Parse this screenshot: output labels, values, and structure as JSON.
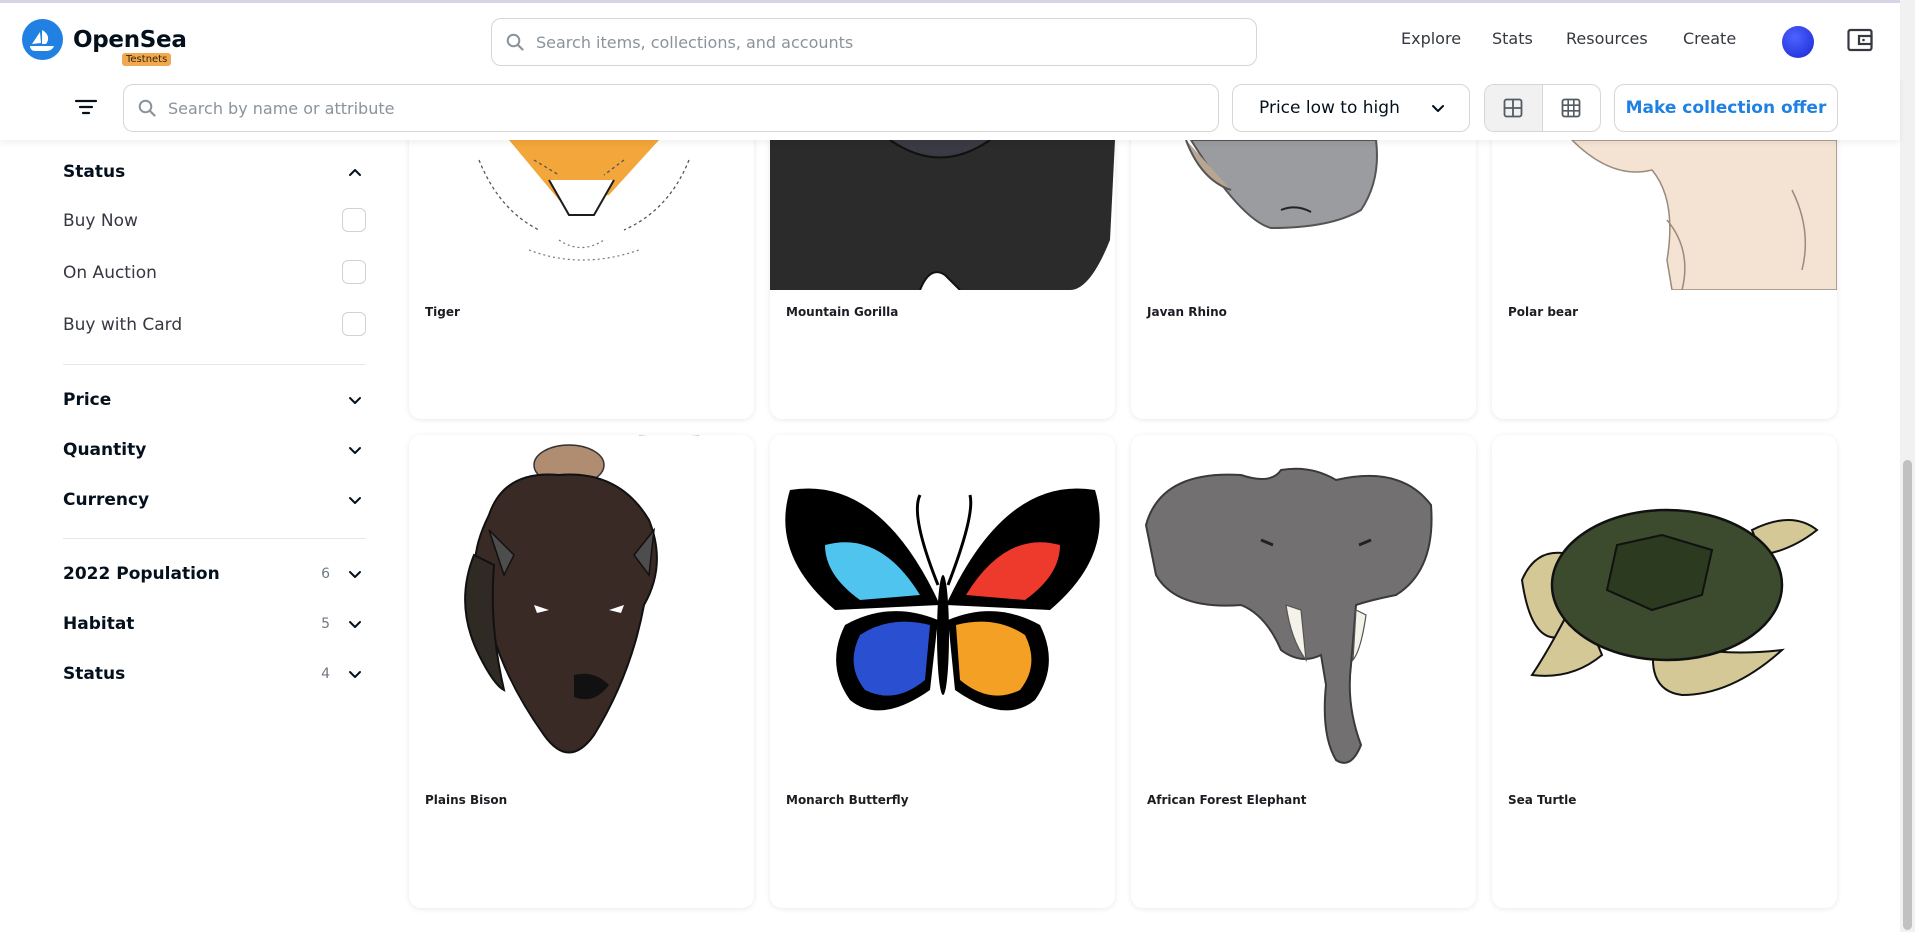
{
  "header": {
    "brand": "OpenSea",
    "badge": "Testnets",
    "search_placeholder": "Search items, collections, and accounts",
    "nav": [
      "Explore",
      "Stats",
      "Resources",
      "Create"
    ]
  },
  "toolbar": {
    "attribute_search_placeholder": "Search by name or attribute",
    "sort_label": "Price low to high",
    "offer_label": "Make collection offer"
  },
  "sidebar": {
    "status_title": "Status",
    "status_options": [
      "Buy Now",
      "On Auction",
      "Buy with Card"
    ],
    "price_title": "Price",
    "quantity_title": "Quantity",
    "currency_title": "Currency",
    "traits": [
      {
        "label": "2022 Population",
        "count": "6"
      },
      {
        "label": "Habitat",
        "count": "5"
      },
      {
        "label": "Status",
        "count": "4"
      }
    ]
  },
  "items": [
    {
      "name": "Tiger",
      "art": "tiger"
    },
    {
      "name": "Mountain Gorilla",
      "art": "gorilla"
    },
    {
      "name": "Javan Rhino",
      "art": "rhino"
    },
    {
      "name": "Polar bear",
      "art": "polarbear"
    },
    {
      "name": "Plains Bison",
      "art": "bison"
    },
    {
      "name": "Monarch Butterfly",
      "art": "butterfly"
    },
    {
      "name": "African Forest Elephant",
      "art": "elephant"
    },
    {
      "name": "Sea Turtle",
      "art": "turtle"
    }
  ],
  "colors": {
    "accent": "#2081e2",
    "badge": "#f0a950"
  }
}
